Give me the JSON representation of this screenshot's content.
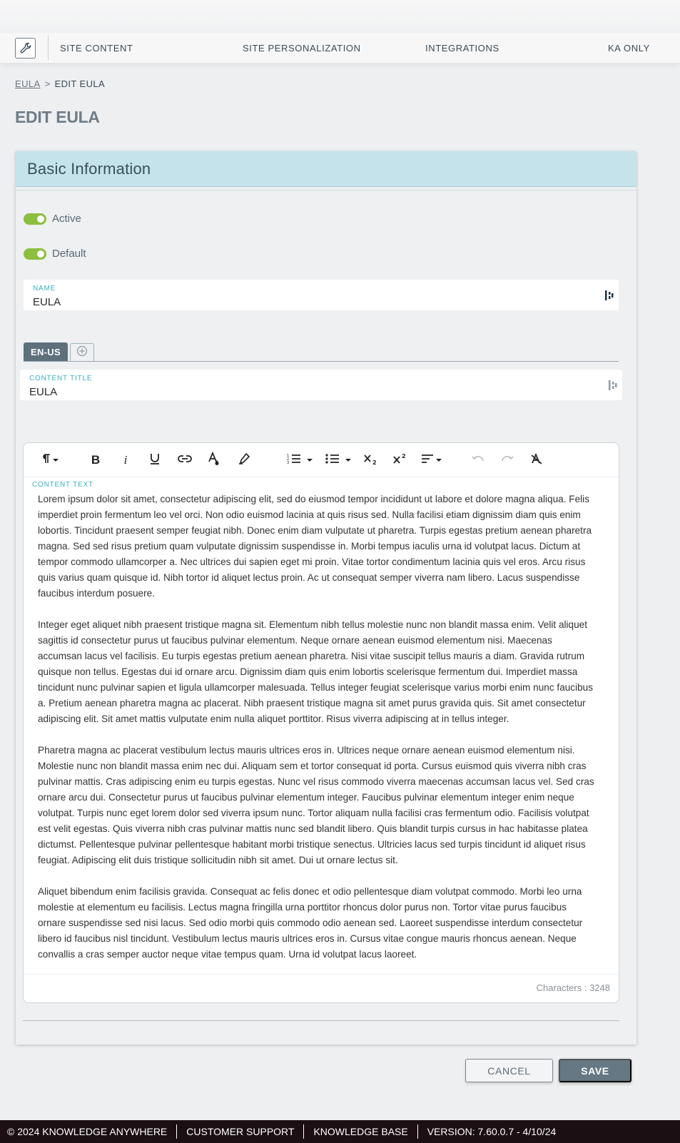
{
  "nav": {
    "items": [
      "SITE CONTENT",
      "SITE PERSONALIZATION",
      "INTEGRATIONS",
      "KA ONLY"
    ]
  },
  "breadcrumb": {
    "parent": "EULA",
    "separator": ">",
    "current": "EDIT EULA"
  },
  "page_title": "EDIT EULA",
  "card": {
    "title": "Basic Information",
    "toggles": {
      "active_label": "Active",
      "default_label": "Default"
    },
    "name_field": {
      "label": "NAME",
      "value": "EULA"
    },
    "language_tab": "EN-US",
    "content_title_field": {
      "label": "CONTENT TITLE",
      "value": "EULA"
    },
    "editor": {
      "content_label": "CONTENT TEXT",
      "paragraphs": [
        "Lorem ipsum dolor sit amet, consectetur adipiscing elit, sed do eiusmod tempor incididunt ut labore et dolore magna aliqua. Felis imperdiet proin fermentum leo vel orci. Non odio euismod lacinia at quis risus sed. Nulla facilisi etiam dignissim diam quis enim lobortis. Tincidunt praesent semper feugiat nibh. Donec enim diam vulputate ut pharetra. Turpis egestas pretium aenean pharetra magna. Sed sed risus pretium quam vulputate dignissim suspendisse in. Morbi tempus iaculis urna id volutpat lacus. Dictum at tempor commodo ullamcorper a. Nec ultrices dui sapien eget mi proin. Vitae tortor condimentum lacinia quis vel eros. Arcu risus quis varius quam quisque id. Nibh tortor id aliquet lectus proin. Ac ut consequat semper viverra nam libero. Lacus suspendisse faucibus interdum posuere.",
        "Integer eget aliquet nibh praesent tristique magna sit. Elementum nibh tellus molestie nunc non blandit massa enim. Velit aliquet sagittis id consectetur purus ut faucibus pulvinar elementum. Neque ornare aenean euismod elementum nisi. Maecenas accumsan lacus vel facilisis. Eu turpis egestas pretium aenean pharetra. Nisi vitae suscipit tellus mauris a diam. Gravida rutrum quisque non tellus. Egestas dui id ornare arcu. Dignissim diam quis enim lobortis scelerisque fermentum dui. Imperdiet massa tincidunt nunc pulvinar sapien et ligula ullamcorper malesuada. Tellus integer feugiat scelerisque varius morbi enim nunc faucibus a. Pretium aenean pharetra magna ac placerat. Nibh praesent tristique magna sit amet purus gravida quis. Sit amet consectetur adipiscing elit. Sit amet mattis vulputate enim nulla aliquet porttitor. Risus viverra adipiscing at in tellus integer.",
        "Pharetra magna ac placerat vestibulum lectus mauris ultrices eros in. Ultrices neque ornare aenean euismod elementum nisi. Molestie nunc non blandit massa enim nec dui. Aliquam sem et tortor consequat id porta. Cursus euismod quis viverra nibh cras pulvinar mattis. Cras adipiscing enim eu turpis egestas. Nunc vel risus commodo viverra maecenas accumsan lacus vel. Sed cras ornare arcu dui. Consectetur purus ut faucibus pulvinar elementum integer. Faucibus pulvinar elementum integer enim neque volutpat. Turpis nunc eget lorem dolor sed viverra ipsum nunc. Tortor aliquam nulla facilisi cras fermentum odio. Facilisis volutpat est velit egestas. Quis viverra nibh cras pulvinar mattis nunc sed blandit libero. Quis blandit turpis cursus in hac habitasse platea dictumst. Pellentesque pulvinar pellentesque habitant morbi tristique senectus. Ultricies lacus sed turpis tincidunt id aliquet risus feugiat. Adipiscing elit duis tristique sollicitudin nibh sit amet. Dui ut ornare lectus sit.",
        "Aliquet bibendum enim facilisis gravida. Consequat ac felis donec et odio pellentesque diam volutpat commodo. Morbi leo urna molestie at elementum eu facilisis. Lectus magna fringilla urna porttitor rhoncus dolor purus non. Tortor vitae purus faucibus ornare suspendisse sed nisi lacus. Sed odio morbi quis commodo odio aenean sed. Laoreet suspendisse interdum consectetur libero id faucibus nisl tincidunt. Vestibulum lectus mauris ultrices eros in. Cursus vitae congue mauris rhoncus aenean. Neque convallis a cras semper auctor neque vitae tempus quam. Urna id volutpat lacus laoreet."
      ],
      "char_count": "Characters : 3248"
    }
  },
  "buttons": {
    "cancel": "CANCEL",
    "save": "SAVE"
  },
  "footer": {
    "copyright": "© 2024 KNOWLEDGE ANYWHERE",
    "support": "CUSTOMER SUPPORT",
    "kb": "KNOWLEDGE BASE",
    "version": "VERSION: 7.60.0.7 - 4/10/24"
  },
  "colors": {
    "header_bg": "#c5e3eb",
    "toggle_on": "#8cbe3f",
    "accent_label": "#3ab0c6",
    "save_button": "#657883",
    "footer_bg": "#1b0f13"
  },
  "icons": {
    "nav": "wrench-icon",
    "field": "translate-icon",
    "add_language": "plus-circle-icon"
  }
}
